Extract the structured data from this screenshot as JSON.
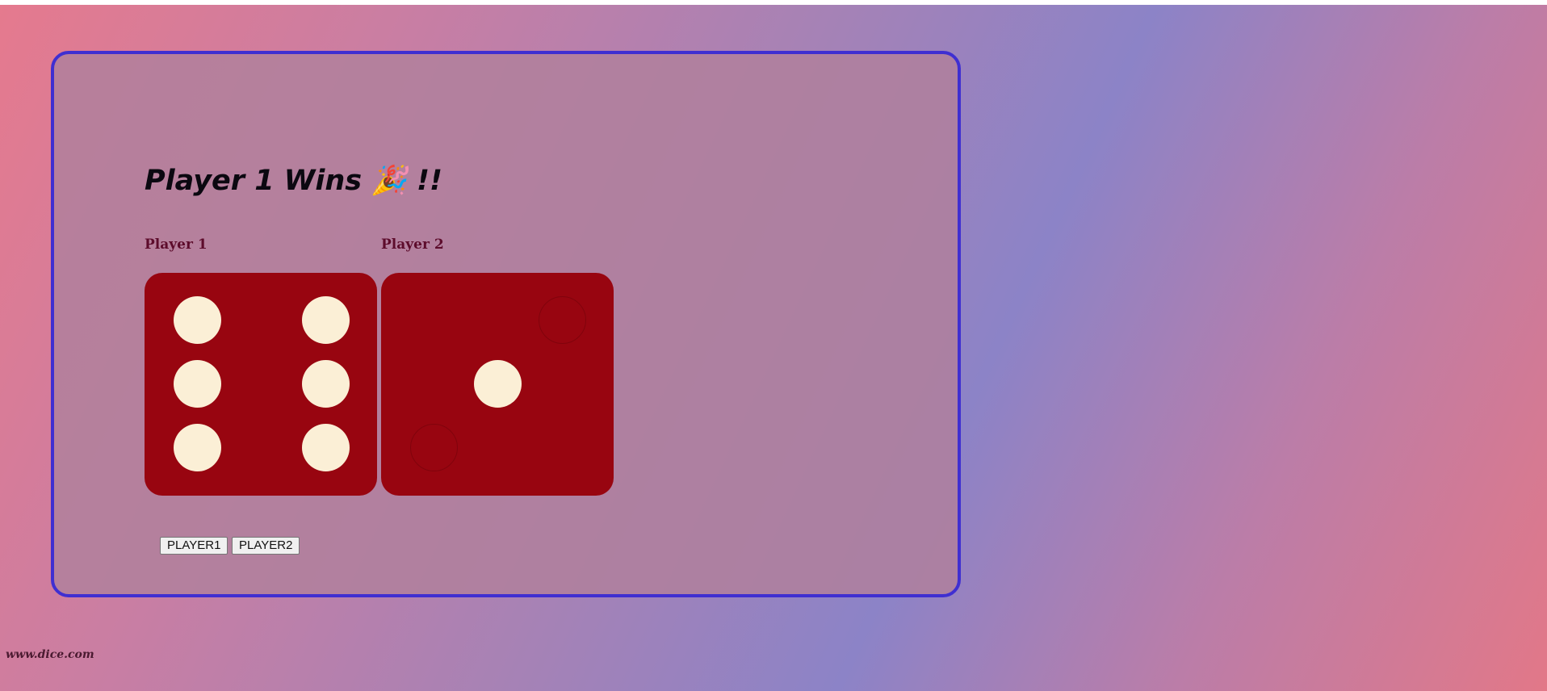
{
  "game": {
    "result_text": "Player 1 Wins 🎉 !!",
    "players": [
      {
        "label": "Player 1",
        "die_value": 6
      },
      {
        "label": "Player 2",
        "die_value": 1
      }
    ],
    "buttons": {
      "player1": "PLAYER1",
      "player2": "PLAYER2"
    }
  },
  "footer": {
    "site": "www.dice.com"
  },
  "colors": {
    "card_border": "#3f2fd1",
    "die_face": "#980510",
    "pip": "#fbefd6"
  }
}
